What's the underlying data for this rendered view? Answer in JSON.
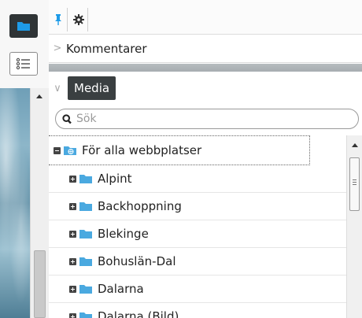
{
  "left_rail": {
    "buttons": [
      {
        "icon": "folder-icon",
        "active": true
      },
      {
        "icon": "list-icon",
        "active": false
      }
    ]
  },
  "toolbar": {
    "buttons": [
      {
        "icon": "pin-icon",
        "color": "#1e9be8"
      },
      {
        "icon": "gear-icon",
        "color": "#333333"
      }
    ]
  },
  "sections": {
    "kommentarer": {
      "label": "Kommentarer"
    },
    "media": {
      "label": "Media"
    }
  },
  "search": {
    "placeholder": "Sök",
    "value": ""
  },
  "tree": {
    "root": {
      "label": "För alla webbplatser",
      "expanded": true
    },
    "children": [
      {
        "label": "Alpint"
      },
      {
        "label": "Backhoppning"
      },
      {
        "label": "Blekinge"
      },
      {
        "label": "Bohuslän-Dal"
      },
      {
        "label": "Dalarna"
      },
      {
        "label": "Dalarna (Bild)"
      }
    ]
  },
  "colors": {
    "accent_blue": "#1e9be8",
    "folder_blue": "#4aa9e0",
    "dark_tab": "#3a3f41"
  }
}
